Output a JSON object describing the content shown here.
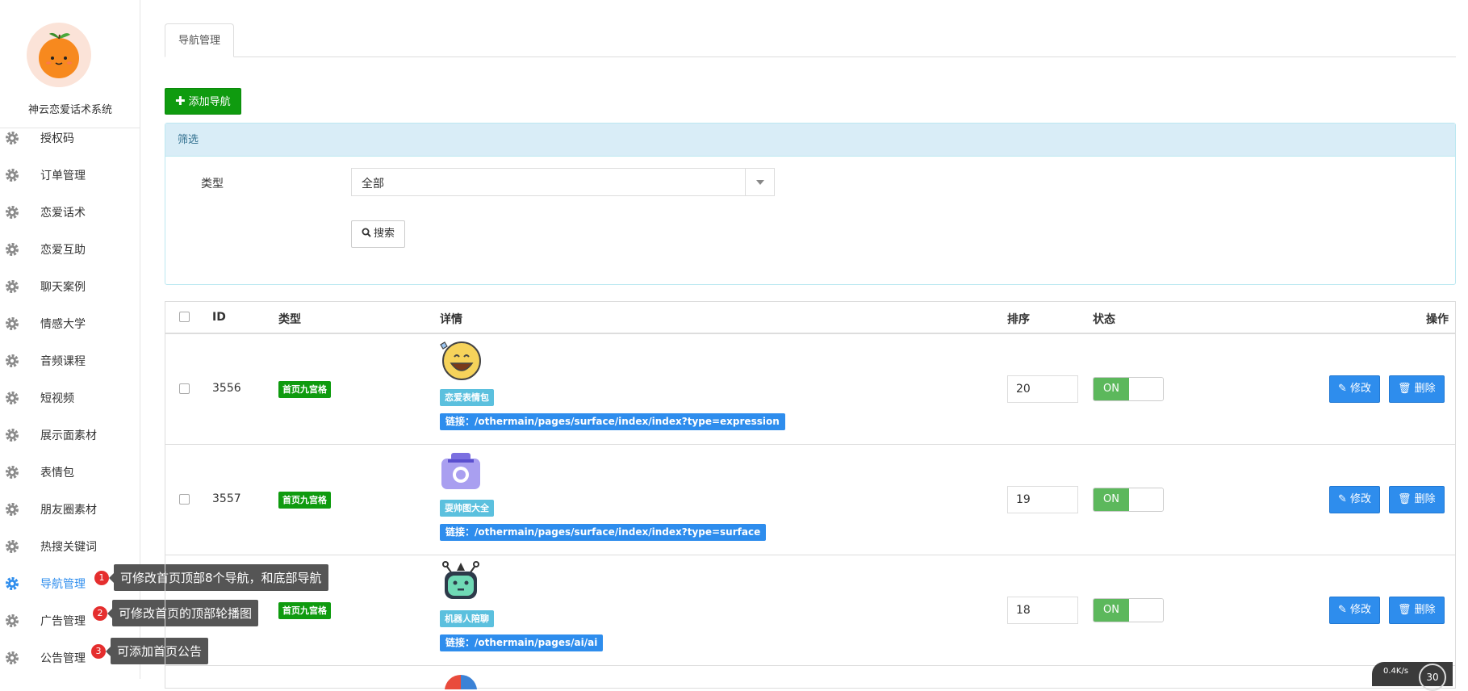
{
  "sidebar": {
    "system_name": "神云恋爱话术系统",
    "items": [
      {
        "label": "授权码",
        "icon": "gear-icon"
      },
      {
        "label": "订单管理",
        "icon": "gear-icon"
      },
      {
        "label": "恋爱话术",
        "icon": "gear-icon"
      },
      {
        "label": "恋爱互助",
        "icon": "gear-icon"
      },
      {
        "label": "聊天案例",
        "icon": "gear-icon"
      },
      {
        "label": "情感大学",
        "icon": "gear-icon"
      },
      {
        "label": "音频课程",
        "icon": "gear-icon"
      },
      {
        "label": "短视频",
        "icon": "gear-icon"
      },
      {
        "label": "展示面素材",
        "icon": "gear-icon"
      },
      {
        "label": "表情包",
        "icon": "gear-icon"
      },
      {
        "label": "朋友圈素材",
        "icon": "gear-icon"
      },
      {
        "label": "热搜关键词",
        "icon": "gear-icon"
      },
      {
        "label": "导航管理",
        "icon": "gear-icon",
        "active": true
      },
      {
        "label": "广告管理",
        "icon": "gear-icon"
      },
      {
        "label": "公告管理",
        "icon": "gear-icon"
      }
    ],
    "active_color": "#2e8ded"
  },
  "tooltips": [
    {
      "num": "1",
      "text": "可修改首页顶部8个导航，和底部导航"
    },
    {
      "num": "2",
      "text": "可修改首页的顶部轮播图"
    },
    {
      "num": "3",
      "text": "可添加首页公告"
    }
  ],
  "tabs": [
    {
      "label": "导航管理"
    }
  ],
  "toolbar": {
    "add_label": "添加导航",
    "add_icon": "plus-icon"
  },
  "filter": {
    "title": "筛选",
    "type_label": "类型",
    "type_value": "全部",
    "search_label": "搜索",
    "search_icon": "search-icon"
  },
  "table": {
    "headers": {
      "id": "ID",
      "type": "类型",
      "detail": "详情",
      "sort": "排序",
      "status": "状态",
      "actions": "操作"
    },
    "rows": [
      {
        "id": "3556",
        "type": "首页九宫格",
        "name": "恋爱表情包",
        "link": "链接：/othermain/pages/surface/index/index?type=expression",
        "sort": "20",
        "status": "ON",
        "icon": "laughing-emoji-icon"
      },
      {
        "id": "3557",
        "type": "首页九宫格",
        "name": "耍帅图大全",
        "link": "链接：/othermain/pages/surface/index/index?type=surface",
        "sort": "19",
        "status": "ON",
        "icon": "camera-icon"
      },
      {
        "id": "",
        "type": "首页九宫格",
        "name": "机器人陪聊",
        "link": "链接：/othermain/pages/ai/ai",
        "sort": "18",
        "status": "ON",
        "icon": "robot-icon"
      }
    ],
    "edit_label": "修改",
    "delete_label": "删除"
  },
  "net_widget": {
    "speed": "0.4K/s",
    "value": "30"
  },
  "colors": {
    "green": "#0f9b0f",
    "blue": "#2e8ded",
    "info": "#5bc0de",
    "switch_on": "#5cb85c"
  }
}
